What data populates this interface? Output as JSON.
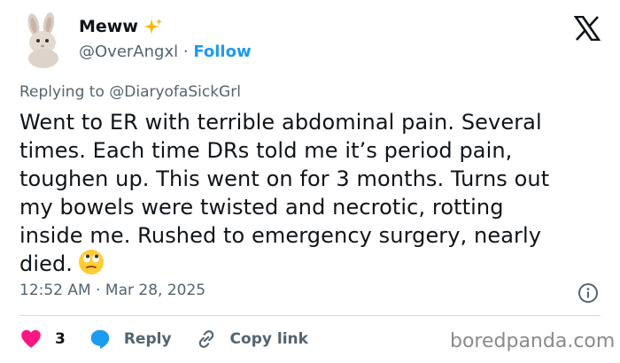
{
  "user": {
    "name": "Meww",
    "name_emoji": "sparkles-icon",
    "handle": "@OverAngxl",
    "separator": "·",
    "follow_label": "Follow"
  },
  "reply": {
    "prefix": "Replying to",
    "mention": "@DiaryofaSickGrl"
  },
  "tweet": {
    "lines": [
      "Went to ER with terrible abdominal pain. Several",
      "times. Each time DRs told me it’s period pain,",
      "toughen up. This went on for 3 months. Turns out",
      "my bowels were twisted and necrotic, rotting",
      "inside me. Rushed to emergency surgery, nearly",
      "died."
    ],
    "trailing_emoji": "eye-roll-emoji-icon"
  },
  "meta": {
    "time": "12:52 AM",
    "separator": "·",
    "date": "Mar 28, 2025"
  },
  "actions": {
    "like_count": "3",
    "reply_label": "Reply",
    "copy_label": "Copy link"
  },
  "watermark": "boredpanda.com",
  "colors": {
    "link_blue": "#1d9bf0",
    "heart_red": "#f91880",
    "muted": "#536471",
    "text": "#0f1419"
  }
}
